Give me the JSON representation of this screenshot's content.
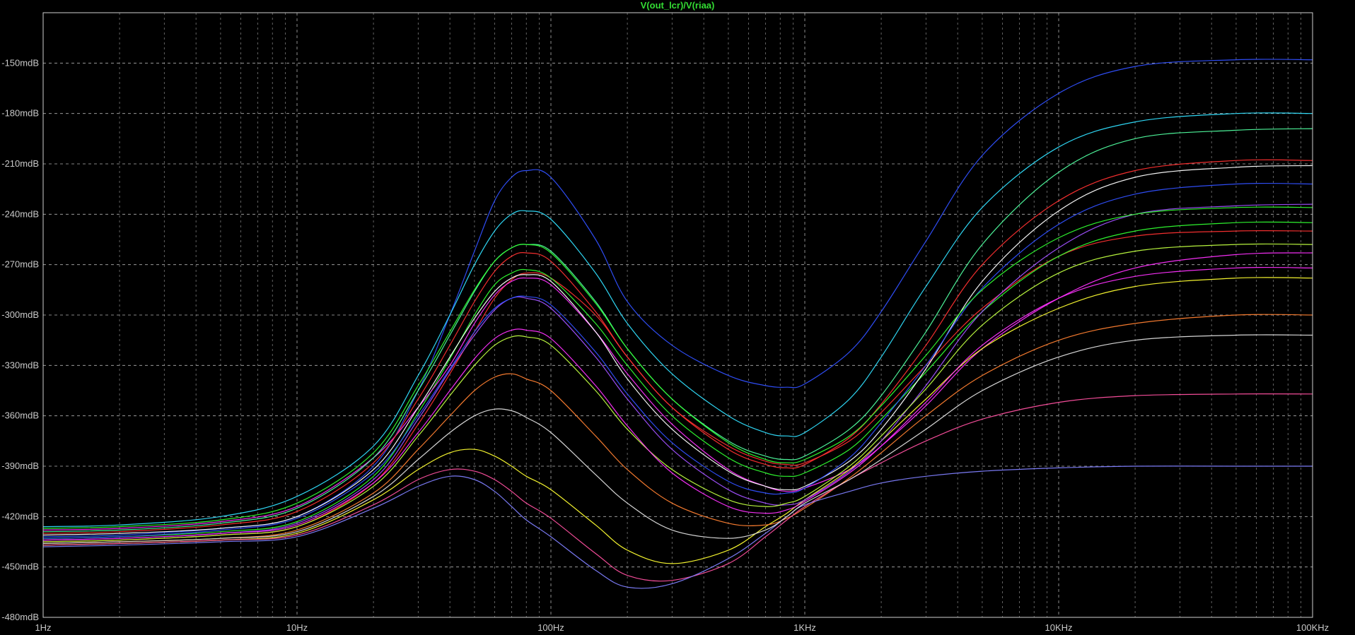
{
  "chart_data": {
    "type": "line",
    "title": "V(out_lcr)/V(riaa)",
    "xlabel": "",
    "ylabel": "",
    "x_scale": "log",
    "xlim": [
      1,
      100000
    ],
    "ylim": [
      -480,
      -120
    ],
    "grid": true,
    "x_ticks": [
      {
        "value": 1,
        "label": "1Hz"
      },
      {
        "value": 10,
        "label": "10Hz"
      },
      {
        "value": 100,
        "label": "100Hz"
      },
      {
        "value": 1000,
        "label": "1KHz"
      },
      {
        "value": 10000,
        "label": "10KHz"
      },
      {
        "value": 100000,
        "label": "100KHz"
      }
    ],
    "y_ticks": [
      {
        "value": -150,
        "label": "-150mdB"
      },
      {
        "value": -180,
        "label": "-180mdB"
      },
      {
        "value": -210,
        "label": "-210mdB"
      },
      {
        "value": -240,
        "label": "-240mdB"
      },
      {
        "value": -270,
        "label": "-270mdB"
      },
      {
        "value": -300,
        "label": "-300mdB"
      },
      {
        "value": -330,
        "label": "-330mdB"
      },
      {
        "value": -360,
        "label": "-360mdB"
      },
      {
        "value": -390,
        "label": "-390mdB"
      },
      {
        "value": -420,
        "label": "-420mdB"
      },
      {
        "value": -450,
        "label": "-450mdB"
      },
      {
        "value": -480,
        "label": "-480mdB"
      }
    ],
    "colors": [
      "#ff3030",
      "#3050ff",
      "#30ff30",
      "#ff30ff",
      "#30e0ff",
      "#ffff30",
      "#ff8030",
      "#a050ff",
      "#ffffff",
      "#50ffa0",
      "#ff50a0",
      "#8080ff",
      "#e0e0e0",
      "#c0ff40"
    ],
    "x": [
      1,
      2,
      5,
      10,
      20,
      30,
      40,
      50,
      60,
      70,
      80,
      100,
      150,
      200,
      300,
      500,
      700,
      850,
      1000,
      1500,
      2000,
      3000,
      5000,
      10000,
      20000,
      50000,
      100000
    ],
    "series": [
      {
        "values": [
          -435,
          -434,
          -431,
          -426,
          -400,
          -365,
          -335,
          -310,
          -290,
          -279,
          -275,
          -278,
          -300,
          -325,
          -355,
          -378,
          -387,
          -389,
          -388,
          -375,
          -358,
          -330,
          -296,
          -265,
          -253,
          -250,
          -250
        ]
      },
      {
        "values": [
          -432,
          -431,
          -427,
          -420,
          -390,
          -345,
          -300,
          -262,
          -232,
          -218,
          -214,
          -218,
          -255,
          -292,
          -318,
          -336,
          -342,
          -343,
          -341,
          -322,
          -298,
          -256,
          -205,
          -168,
          -152,
          -148,
          -148
        ]
      },
      {
        "values": [
          -433,
          -432,
          -429,
          -423,
          -396,
          -358,
          -326,
          -300,
          -282,
          -275,
          -273,
          -278,
          -305,
          -330,
          -360,
          -385,
          -394,
          -396,
          -394,
          -380,
          -362,
          -334,
          -298,
          -265,
          -250,
          -245,
          -245
        ]
      },
      {
        "values": [
          -428,
          -427,
          -423,
          -414,
          -385,
          -355,
          -330,
          -305,
          -288,
          -280,
          -278,
          -282,
          -310,
          -335,
          -365,
          -392,
          -402,
          -405,
          -403,
          -392,
          -378,
          -354,
          -320,
          -290,
          -272,
          -264,
          -263
        ]
      },
      {
        "values": [
          -426,
          -425,
          -420,
          -408,
          -378,
          -336,
          -300,
          -270,
          -250,
          -240,
          -238,
          -243,
          -275,
          -305,
          -335,
          -360,
          -370,
          -372,
          -370,
          -350,
          -325,
          -283,
          -236,
          -200,
          -185,
          -180,
          -180
        ]
      },
      {
        "values": [
          -437,
          -436,
          -434,
          -430,
          -410,
          -392,
          -382,
          -380,
          -384,
          -390,
          -396,
          -404,
          -425,
          -440,
          -448,
          -440,
          -426,
          -418,
          -410,
          -392,
          -375,
          -350,
          -320,
          -296,
          -283,
          -278,
          -278
        ]
      },
      {
        "values": [
          -436,
          -435,
          -433,
          -428,
          -406,
          -380,
          -360,
          -345,
          -337,
          -335,
          -338,
          -345,
          -372,
          -392,
          -412,
          -424,
          -425,
          -421,
          -415,
          -397,
          -382,
          -360,
          -336,
          -315,
          -305,
          -300,
          -300
        ]
      },
      {
        "values": [
          -434,
          -433,
          -430,
          -424,
          -398,
          -362,
          -333,
          -312,
          -297,
          -290,
          -290,
          -296,
          -325,
          -350,
          -380,
          -404,
          -412,
          -413,
          -410,
          -393,
          -375,
          -342,
          -298,
          -260,
          -240,
          -235,
          -234
        ]
      },
      {
        "values": [
          -431,
          -430,
          -427,
          -420,
          -392,
          -355,
          -325,
          -302,
          -286,
          -278,
          -276,
          -280,
          -310,
          -338,
          -368,
          -393,
          -402,
          -404,
          -402,
          -387,
          -368,
          -332,
          -280,
          -238,
          -218,
          -212,
          -211
        ]
      },
      {
        "values": [
          -429,
          -428,
          -424,
          -415,
          -385,
          -345,
          -312,
          -286,
          -268,
          -260,
          -258,
          -262,
          -292,
          -320,
          -350,
          -375,
          -384,
          -386,
          -384,
          -368,
          -348,
          -310,
          -258,
          -215,
          -195,
          -190,
          -189
        ]
      },
      {
        "values": [
          -437,
          -436,
          -434,
          -431,
          -413,
          -398,
          -392,
          -393,
          -398,
          -405,
          -412,
          -421,
          -442,
          -455,
          -458,
          -448,
          -432,
          -422,
          -414,
          -398,
          -388,
          -375,
          -362,
          -352,
          -348,
          -347,
          -347
        ]
      },
      {
        "values": [
          -438,
          -437,
          -435,
          -432,
          -415,
          -402,
          -396,
          -398,
          -405,
          -414,
          -422,
          -432,
          -452,
          -462,
          -460,
          -445,
          -430,
          -420,
          -413,
          -405,
          -400,
          -396,
          -393,
          -391,
          -390,
          -390,
          -390
        ]
      },
      {
        "values": [
          -436,
          -435,
          -433,
          -429,
          -408,
          -386,
          -370,
          -360,
          -356,
          -357,
          -361,
          -370,
          -395,
          -412,
          -428,
          -433,
          -428,
          -420,
          -412,
          -398,
          -386,
          -368,
          -345,
          -325,
          -315,
          -312,
          -312
        ]
      },
      {
        "values": [
          -435,
          -434,
          -431,
          -426,
          -402,
          -372,
          -348,
          -330,
          -318,
          -313,
          -313,
          -318,
          -345,
          -368,
          -392,
          -410,
          -414,
          -412,
          -408,
          -390,
          -372,
          -344,
          -306,
          -275,
          -262,
          -258,
          -258
        ]
      },
      {
        "values": [
          -430,
          -429,
          -425,
          -417,
          -388,
          -350,
          -318,
          -292,
          -274,
          -265,
          -263,
          -268,
          -298,
          -325,
          -355,
          -380,
          -389,
          -391,
          -389,
          -373,
          -353,
          -318,
          -270,
          -232,
          -214,
          -208,
          -208
        ]
      },
      {
        "values": [
          -433,
          -432,
          -428,
          -421,
          -394,
          -360,
          -332,
          -310,
          -296,
          -290,
          -289,
          -294,
          -322,
          -347,
          -376,
          -399,
          -406,
          -406,
          -403,
          -385,
          -364,
          -330,
          -284,
          -246,
          -228,
          -222,
          -222
        ]
      },
      {
        "values": [
          -427,
          -426,
          -422,
          -412,
          -382,
          -342,
          -310,
          -285,
          -268,
          -260,
          -258,
          -263,
          -293,
          -320,
          -350,
          -376,
          -386,
          -388,
          -386,
          -372,
          -354,
          -324,
          -285,
          -254,
          -240,
          -236,
          -236
        ]
      },
      {
        "values": [
          -434,
          -433,
          -430,
          -425,
          -400,
          -370,
          -345,
          -326,
          -314,
          -309,
          -309,
          -314,
          -342,
          -366,
          -394,
          -414,
          -418,
          -416,
          -411,
          -394,
          -378,
          -352,
          -318,
          -290,
          -277,
          -272,
          -272
        ]
      }
    ]
  }
}
